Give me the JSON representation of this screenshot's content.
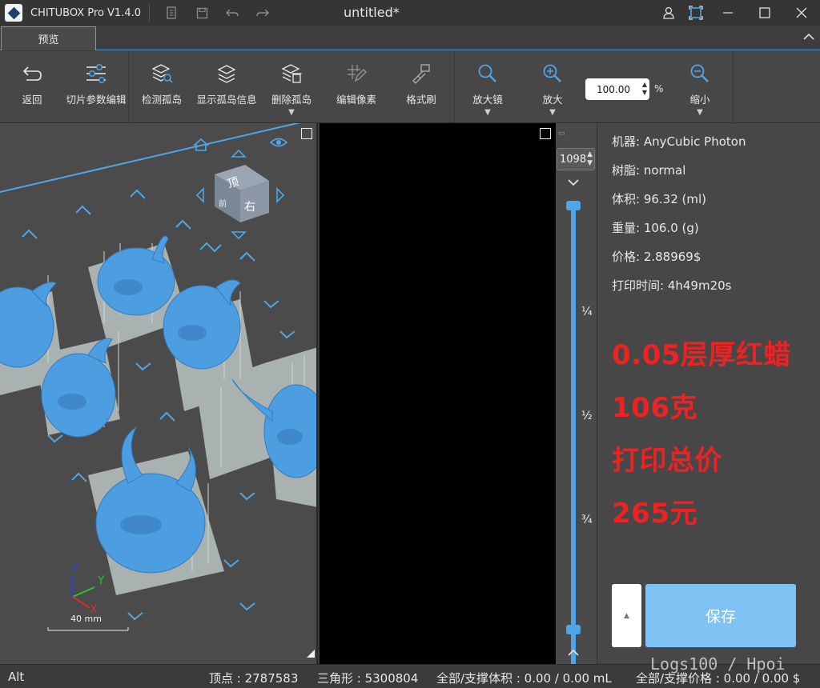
{
  "titlebar": {
    "app_name": "CHITUBOX Pro V1.4.0",
    "document_title": "untitled*"
  },
  "tabs": [
    {
      "label": "预览",
      "active": true
    }
  ],
  "toolbar": {
    "back": "返回",
    "slice_params": "切片参数编辑",
    "detect_islands": "检测孤岛",
    "show_island_info": "显示孤岛信息",
    "delete_islands": "删除孤岛",
    "edit_pixels": "编辑像素",
    "format_brush": "格式刷",
    "magnifier": "放大镜",
    "zoom_in": "放大",
    "zoom_value": "100.00",
    "zoom_unit": "%",
    "zoom_out": "缩小"
  },
  "viewport": {
    "cube_top": "顶",
    "cube_right": "右",
    "cube_front": "前",
    "axis_z": "Z",
    "axis_y": "Y",
    "axis_x": "X",
    "scale_label": "40 mm",
    "colors": {
      "model": "#4d9ee0",
      "support": "#a9b2b0",
      "grid": "#4ea6e6"
    }
  },
  "layer_slider": {
    "current_layer": "1098",
    "quarter": "¼",
    "half": "½",
    "three_quarter": "¾",
    "position": 1.0
  },
  "info": {
    "machine": "机器:  AnyCubic Photon",
    "resin": "树脂:  normal",
    "volume": "体积:  96.32  (ml)",
    "weight": "重量:  106.0  (g)",
    "price": "价格:  2.88969$",
    "print_time": "打印时间:  4h49m20s"
  },
  "annotations": {
    "line1": "0.05层厚红蜡",
    "line2": "106克",
    "line3": "打印总价",
    "line4": "265元",
    "color": "#ee2222"
  },
  "save_button": "保存",
  "statusbar": {
    "mode": "Alt",
    "vertices": "顶点 : 2787583",
    "triangles": "三角形 : 5300804",
    "volume": "全部/支撑体积 : 0.00 / 0.00 mL",
    "price": "全部/支撑价格 : 0.00 / 0.00 $"
  },
  "watermark": "Logs100 / Hpoi"
}
